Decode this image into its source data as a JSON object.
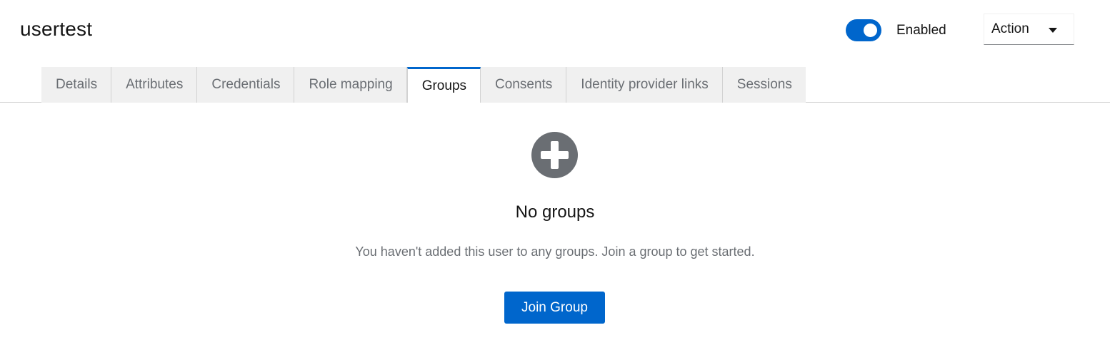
{
  "header": {
    "title": "usertest",
    "enabled_label": "Enabled",
    "enabled": true,
    "action_label": "Action"
  },
  "tabs": [
    {
      "label": "Details",
      "active": false
    },
    {
      "label": "Attributes",
      "active": false
    },
    {
      "label": "Credentials",
      "active": false
    },
    {
      "label": "Role mapping",
      "active": false
    },
    {
      "label": "Groups",
      "active": true
    },
    {
      "label": "Consents",
      "active": false
    },
    {
      "label": "Identity provider links",
      "active": false
    },
    {
      "label": "Sessions",
      "active": false
    }
  ],
  "empty_state": {
    "icon": "plus-circle-icon",
    "title": "No groups",
    "body": "You haven't added this user to any groups. Join a group to get started.",
    "button_label": "Join Group"
  },
  "colors": {
    "accent": "#0066cc",
    "muted_text": "#6a6e73",
    "tab_background": "#f0f0f0"
  }
}
